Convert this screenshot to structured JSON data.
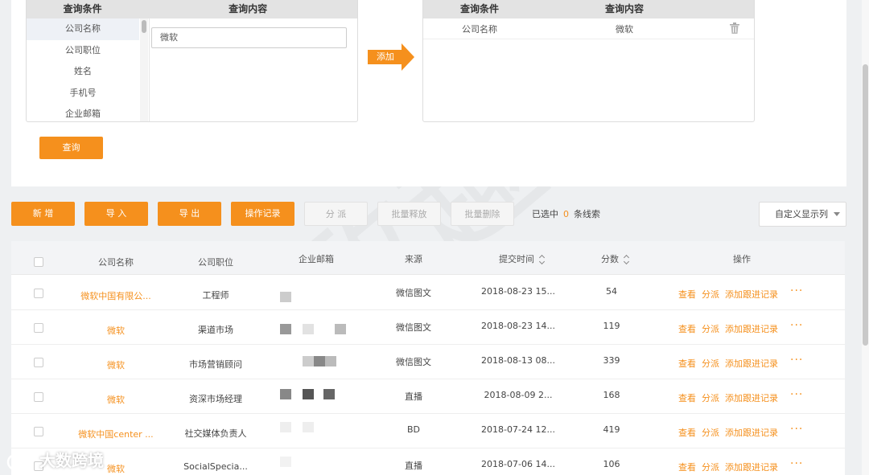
{
  "query": {
    "left_headers": [
      "查询条件",
      "查询内容"
    ],
    "conditions": [
      "公司名称",
      "公司职位",
      "姓名",
      "手机号",
      "企业邮箱"
    ],
    "input_value": "微软",
    "add_label": "添加",
    "right_headers": [
      "查询条件",
      "查询内容"
    ],
    "result": {
      "condition": "公司名称",
      "content": "微软"
    },
    "query_button": "查询"
  },
  "toolbar": {
    "new": "新 增",
    "import": "导 入",
    "export": "导 出",
    "log": "操作记录",
    "assign": "分 派",
    "batch_release": "批量释放",
    "batch_delete": "批量删除",
    "selected_prefix": "已选中",
    "selected_count": "0",
    "selected_suffix": "条线索",
    "custom_columns": "自定义显示列"
  },
  "table": {
    "headers": {
      "company": "公司名称",
      "position": "公司职位",
      "email": "企业邮箱",
      "source": "来源",
      "submit_time": "提交时间",
      "score": "分数",
      "actions": "操作"
    },
    "op_labels": {
      "view": "查看",
      "assign": "分派",
      "add_follow": "添加跟进记录",
      "more": "···"
    },
    "rows": [
      {
        "company": "微软中国有限公...",
        "position": "工程师",
        "source": "微信图文",
        "time": "2018-08-23 15...",
        "score": "54"
      },
      {
        "company": "微软",
        "position": "渠道市场",
        "source": "微信图文",
        "time": "2018-08-23 14...",
        "score": "119"
      },
      {
        "company": "微软",
        "position": "市场营销顾问",
        "source": "微信图文",
        "time": "2018-08-13 08...",
        "score": "339"
      },
      {
        "company": "微软",
        "position": "资深市场经理",
        "source": "直播",
        "time": "2018-08-09 2...",
        "score": "168"
      },
      {
        "company": "微软中国center ...",
        "position": "社交媒体负责人",
        "source": "BD",
        "time": "2018-07-24 12...",
        "score": "419"
      },
      {
        "company": "微软",
        "position": "SocialSpecia...",
        "source": "直播",
        "time": "2018-07-06 14...",
        "score": "106"
      }
    ]
  },
  "watermark": "致趣百川",
  "brand": "大数跨境"
}
